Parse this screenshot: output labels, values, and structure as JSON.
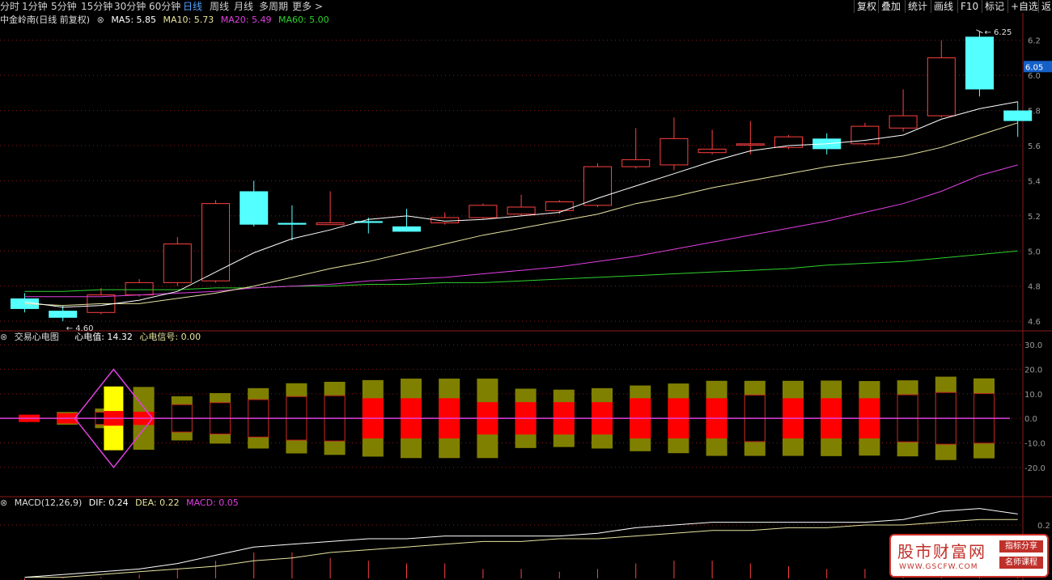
{
  "toolbar": {
    "tabs": [
      "分时",
      "1分钟",
      "5分钟",
      "15分钟",
      "30分钟",
      "60分钟",
      "日线",
      "周线",
      "月线",
      "多周期",
      "更多 >"
    ],
    "active_tab": "日线",
    "right_buttons": [
      "复权",
      "叠加",
      "统计",
      "画线",
      "F10",
      "标记",
      "+自选",
      "返回"
    ]
  },
  "colors": {
    "up": "#ff4040",
    "down": "#54ffff",
    "ma5": "#ffffff",
    "ma10": "#e8e4a0",
    "ma20": "#e040e0",
    "ma60": "#2fd12f",
    "grid": "#8b1a1a",
    "axis": "#9a9a9a"
  },
  "main_legend": {
    "name": "中金岭南(日线 前复权)",
    "ma5": "MA5: 5.85",
    "ma10": "MA10: 5.73",
    "ma20": "MA20: 5.49",
    "ma60": "MA60: 5.00"
  },
  "ecg_legend": {
    "name": "交易心电图",
    "value": "心电值: 14.32",
    "signal": "心电信号: 0.00"
  },
  "macd_legend": {
    "name": "MACD(12,26,9)",
    "dif": "DIF: 0.24",
    "dea": "DEA: 0.22",
    "macd": "MACD: 0.05"
  },
  "watermark": {
    "title": "股市财富网",
    "url": "WWW.GSCFW.COM",
    "tag1": "指标分享",
    "tag2": "名师课程"
  },
  "chart_data": [
    {
      "type": "candlestick",
      "ylim": [
        4.55,
        6.3
      ],
      "yticks": [
        4.6,
        4.8,
        5.0,
        5.2,
        5.4,
        5.6,
        5.8,
        6.0,
        6.2
      ],
      "price_tag": "6.05",
      "high_label": "6.25",
      "low_label": "4.60",
      "candles": [
        {
          "o": 4.73,
          "h": 4.76,
          "l": 4.65,
          "c": 4.67
        },
        {
          "o": 4.66,
          "h": 4.69,
          "l": 4.6,
          "c": 4.62
        },
        {
          "o": 4.65,
          "h": 4.79,
          "l": 4.64,
          "c": 4.75
        },
        {
          "o": 4.75,
          "h": 4.84,
          "l": 4.74,
          "c": 4.82
        },
        {
          "o": 4.82,
          "h": 5.08,
          "l": 4.8,
          "c": 5.04
        },
        {
          "o": 4.83,
          "h": 5.29,
          "l": 4.82,
          "c": 5.27
        },
        {
          "o": 5.34,
          "h": 5.4,
          "l": 5.14,
          "c": 5.15
        },
        {
          "o": 5.16,
          "h": 5.26,
          "l": 5.06,
          "c": 5.15
        },
        {
          "o": 5.15,
          "h": 5.34,
          "l": 5.15,
          "c": 5.16
        },
        {
          "o": 5.17,
          "h": 5.19,
          "l": 5.1,
          "c": 5.16
        },
        {
          "o": 5.14,
          "h": 5.24,
          "l": 5.11,
          "c": 5.11
        },
        {
          "o": 5.16,
          "h": 5.22,
          "l": 5.15,
          "c": 5.19
        },
        {
          "o": 5.19,
          "h": 5.27,
          "l": 5.18,
          "c": 5.26
        },
        {
          "o": 5.21,
          "h": 5.32,
          "l": 5.2,
          "c": 5.25
        },
        {
          "o": 5.23,
          "h": 5.29,
          "l": 5.21,
          "c": 5.28
        },
        {
          "o": 5.26,
          "h": 5.5,
          "l": 5.25,
          "c": 5.48
        },
        {
          "o": 5.48,
          "h": 5.7,
          "l": 5.47,
          "c": 5.52
        },
        {
          "o": 5.49,
          "h": 5.76,
          "l": 5.46,
          "c": 5.64
        },
        {
          "o": 5.56,
          "h": 5.69,
          "l": 5.55,
          "c": 5.58
        },
        {
          "o": 5.61,
          "h": 5.74,
          "l": 5.55,
          "c": 5.61
        },
        {
          "o": 5.59,
          "h": 5.66,
          "l": 5.58,
          "c": 5.65
        },
        {
          "o": 5.64,
          "h": 5.67,
          "l": 5.55,
          "c": 5.58
        },
        {
          "o": 5.61,
          "h": 5.73,
          "l": 5.6,
          "c": 5.71
        },
        {
          "o": 5.7,
          "h": 5.92,
          "l": 5.68,
          "c": 5.77
        },
        {
          "o": 5.77,
          "h": 6.2,
          "l": 5.76,
          "c": 6.1
        },
        {
          "o": 6.22,
          "h": 6.25,
          "l": 5.88,
          "c": 5.92
        },
        {
          "o": 5.8,
          "h": 5.85,
          "l": 5.65,
          "c": 5.74
        }
      ],
      "ma5": [
        4.71,
        4.68,
        4.69,
        4.72,
        4.77,
        4.88,
        4.99,
        5.07,
        5.12,
        5.18,
        5.2,
        5.17,
        5.18,
        5.2,
        5.22,
        5.3,
        5.37,
        5.44,
        5.51,
        5.57,
        5.6,
        5.61,
        5.63,
        5.66,
        5.75,
        5.81,
        5.85
      ],
      "ma10": [
        4.7,
        4.69,
        4.7,
        4.7,
        4.73,
        4.76,
        4.8,
        4.85,
        4.9,
        4.94,
        4.99,
        5.04,
        5.09,
        5.13,
        5.17,
        5.21,
        5.27,
        5.31,
        5.36,
        5.4,
        5.44,
        5.48,
        5.51,
        5.54,
        5.59,
        5.66,
        5.73
      ],
      "ma20": [
        4.74,
        4.74,
        4.74,
        4.75,
        4.76,
        4.77,
        4.79,
        4.8,
        4.81,
        4.83,
        4.84,
        4.85,
        4.87,
        4.89,
        4.91,
        4.94,
        4.97,
        5.01,
        5.05,
        5.09,
        5.13,
        5.17,
        5.22,
        5.27,
        5.34,
        5.43,
        5.49
      ],
      "ma60": [
        4.77,
        4.77,
        4.78,
        4.78,
        4.78,
        4.79,
        4.79,
        4.8,
        4.8,
        4.81,
        4.81,
        4.82,
        4.82,
        4.83,
        4.84,
        4.85,
        4.86,
        4.87,
        4.88,
        4.89,
        4.9,
        4.92,
        4.93,
        4.94,
        4.96,
        4.98,
        5.0
      ]
    },
    {
      "type": "bar",
      "title": "交易心电图",
      "ylim": [
        -26,
        36
      ],
      "yticks": [
        -20.0,
        -10.0,
        0.0,
        10.0,
        20.0,
        30.0
      ],
      "amplitude": [
        0.6,
        0.6,
        1.0,
        2.6,
        4.0,
        12.8,
        9.0,
        10.3,
        12.3,
        14.3,
        14.9,
        15.6,
        16.2,
        16.2,
        16.2,
        12.1,
        11.7,
        12.3,
        13.4,
        14.2,
        15.3,
        15.3,
        15.3,
        15.4,
        15.2,
        15.5,
        17.0,
        16.3,
        14.3
      ],
      "red_core": [
        0.4,
        0.4,
        1.5,
        2.1,
        0,
        2.7,
        0,
        0,
        0,
        0,
        0,
        8.2,
        8.2,
        8.2,
        6.6,
        6.6,
        6.6,
        6.6,
        8.2,
        8.2,
        8.2,
        0,
        8.2,
        8.2,
        8.2,
        0,
        0,
        0,
        0
      ],
      "signal": [
        0,
        0,
        0,
        0,
        0,
        0,
        0,
        0,
        0,
        0,
        0,
        0,
        0,
        0,
        0,
        0,
        0,
        0,
        0,
        0,
        0,
        0,
        0,
        0,
        0,
        0,
        0,
        0,
        0
      ],
      "marker": {
        "index": 4,
        "range": [
          -20,
          20
        ]
      }
    },
    {
      "type": "line",
      "title": "MACD(12,26,9)",
      "ylim": [
        0,
        0.35
      ],
      "yticks": [
        0.2
      ],
      "dif": [
        0.01,
        0.02,
        0.03,
        0.04,
        0.06,
        0.09,
        0.12,
        0.13,
        0.14,
        0.15,
        0.15,
        0.16,
        0.16,
        0.16,
        0.16,
        0.17,
        0.19,
        0.2,
        0.21,
        0.21,
        0.21,
        0.21,
        0.21,
        0.22,
        0.25,
        0.26,
        0.24
      ],
      "dea": [
        0.01,
        0.01,
        0.02,
        0.03,
        0.04,
        0.05,
        0.07,
        0.08,
        0.1,
        0.11,
        0.12,
        0.13,
        0.14,
        0.14,
        0.15,
        0.15,
        0.16,
        0.17,
        0.18,
        0.18,
        0.19,
        0.19,
        0.2,
        0.2,
        0.21,
        0.22,
        0.22
      ],
      "macd": [
        0.0,
        0.01,
        0.01,
        0.02,
        0.04,
        0.07,
        0.1,
        0.1,
        0.08,
        0.07,
        0.06,
        0.06,
        0.04,
        0.04,
        0.03,
        0.04,
        0.06,
        0.07,
        0.07,
        0.06,
        0.05,
        0.04,
        0.04,
        0.05,
        0.08,
        0.08,
        0.05
      ]
    }
  ]
}
